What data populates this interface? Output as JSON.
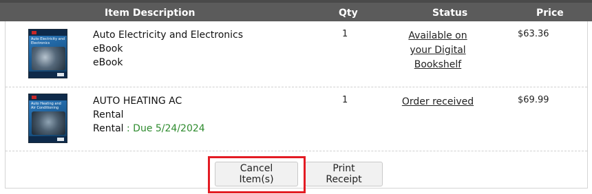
{
  "table": {
    "headers": {
      "description": "Item Description",
      "qty": "Qty",
      "status": "Status",
      "price": "Price"
    },
    "rows": [
      {
        "cover_icon": "book-cover-auto-electricity",
        "cover_title": "Auto Electricity and Electronics",
        "title": "Auto Electricity and Electronics",
        "line2": "eBook",
        "line3": "eBook",
        "qty": "1",
        "status_line1": "Available on",
        "status_line2": "your Digital",
        "status_line3": "Bookshelf",
        "price": "$63.36"
      },
      {
        "cover_icon": "book-cover-auto-heating-ac",
        "cover_title": "Auto Heating and Air Conditioning",
        "title": "AUTO HEATING AC",
        "line2": "Rental",
        "line3_prefix": "Rental",
        "line3_separator": " : ",
        "line3_due": "Due 5/24/2024",
        "qty": "1",
        "status": "Order received",
        "price": "$69.99"
      }
    ]
  },
  "actions": {
    "cancel_label": "Cancel Item(s)",
    "print_label": "Print Receipt"
  },
  "colors": {
    "header_bg": "#5b5b5b",
    "due_text": "#2e8b2e",
    "highlight": "#e31b23"
  }
}
